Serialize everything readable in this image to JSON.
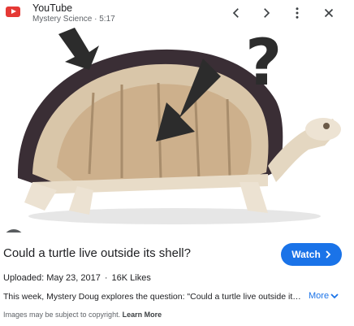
{
  "source": {
    "name": "YouTube",
    "channel_duration": "Mystery Science · 5:17"
  },
  "header_icons": [
    "youtube-logo-icon",
    "chevron-left-icon",
    "chevron-right-icon",
    "more-vert-icon",
    "close-icon"
  ],
  "image": {
    "description_icon": "google-lens-icon"
  },
  "result": {
    "title": "Could a turtle live outside its shell?",
    "watch_label": "Watch",
    "uploaded": "Uploaded: May 23, 2017",
    "likes": "16K Likes",
    "separator": "·",
    "description": "This week, Mystery Doug explores the question: \"Could a turtle live outside its shell?\"",
    "more_label": "More",
    "copyright_text": "Images may be subject to copyright.",
    "learn_more": "Learn More"
  },
  "colors": {
    "accent": "#1a73e8",
    "youtube_red": "#e53935"
  }
}
